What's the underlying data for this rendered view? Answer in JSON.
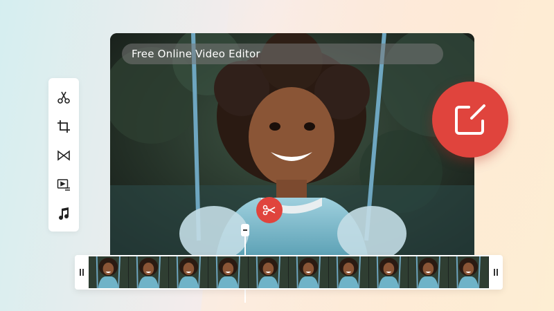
{
  "video": {
    "title": "Free Online Video Editor"
  },
  "toolbar": {
    "tools": [
      {
        "name": "cut",
        "icon": "scissors-icon"
      },
      {
        "name": "crop",
        "icon": "crop-icon"
      },
      {
        "name": "transition",
        "icon": "transition-icon"
      },
      {
        "name": "subtitle",
        "icon": "video-subtitle-icon"
      },
      {
        "name": "music",
        "icon": "music-note-icon"
      }
    ]
  },
  "edit_badge": {
    "icon": "edit-square-icon"
  },
  "split_marker": {
    "icon": "scissors-icon"
  },
  "timeline": {
    "frame_count": 10
  },
  "colors": {
    "accent": "#e0443d",
    "panel": "#ffffff"
  }
}
